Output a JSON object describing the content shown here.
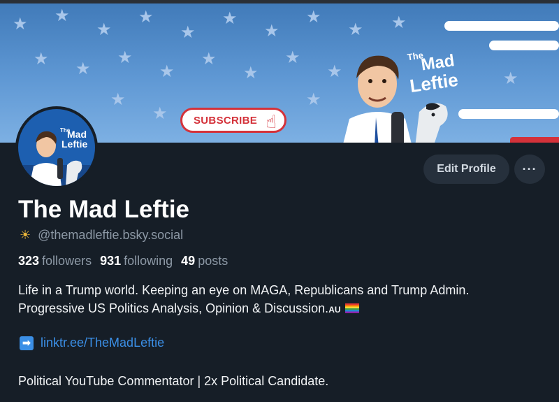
{
  "banner": {
    "subscribe_label": "SUBSCRIBE",
    "logo_the": "The",
    "logo_mad": "Mad",
    "logo_leftie": "Leftie"
  },
  "avatar": {
    "logo_the": "The",
    "logo_mad": "Mad",
    "logo_leftie": "Leftie"
  },
  "actions": {
    "edit_profile": "Edit Profile",
    "more": "···"
  },
  "profile": {
    "display_name": "The Mad Leftie",
    "handle_icon": "☀",
    "handle": "@themadleftie.bsky.social"
  },
  "stats": {
    "followers_count": "323",
    "followers_label": "followers",
    "following_count": "931",
    "following_label": "following",
    "posts_count": "49",
    "posts_label": "posts"
  },
  "bio": {
    "line1": "Life in a Trump world. Keeping an eye on MAGA, Republicans and Trump Admin.",
    "line2": "Progressive US Politics Analysis, Opinion & Discussion.",
    "line2_suffix": "AU",
    "flag_icon": "rainbow-flag-icon",
    "link_icon": "➡",
    "link": "linktr.ee/TheMadLeftie",
    "line3": "Political YouTube Commentator | 2x Political Candidate."
  },
  "colors": {
    "background": "#161e27",
    "accent": "#3b8fe6",
    "banner_blue": "#4f88c6",
    "subscribe_red": "#d4323a"
  }
}
